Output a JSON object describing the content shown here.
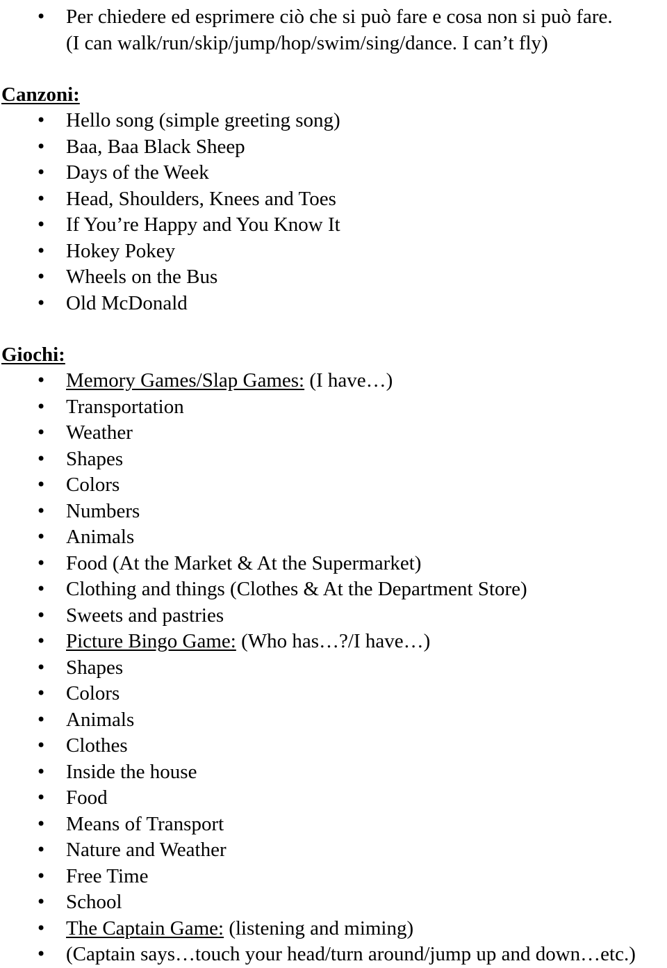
{
  "document": {
    "bullet_glyph": "•",
    "intro": {
      "line1": "Per chiedere ed esprimere ciò che si può fare e cosa non si può fare.",
      "line2": "(I can walk/run/skip/jump/hop/swim/sing/dance. I can’t fly)"
    },
    "sections": [
      {
        "heading": "Canzoni:",
        "items": [
          {
            "text": "Hello song (simple greeting song)",
            "underlined_prefix": ""
          },
          {
            "text": "Baa, Baa Black Sheep",
            "underlined_prefix": ""
          },
          {
            "text": "Days of the Week",
            "underlined_prefix": ""
          },
          {
            "text": "Head, Shoulders, Knees and Toes",
            "underlined_prefix": ""
          },
          {
            "text": "If You’re Happy and You Know It",
            "underlined_prefix": ""
          },
          {
            "text": "Hokey Pokey",
            "underlined_prefix": ""
          },
          {
            "text": "Wheels on the Bus",
            "underlined_prefix": ""
          },
          {
            "text": "Old McDonald",
            "underlined_prefix": ""
          }
        ]
      },
      {
        "heading": "Giochi:",
        "items": [
          {
            "underlined_prefix": "Memory Games/Slap Games:",
            "text": " (I have…)"
          },
          {
            "underlined_prefix": "",
            "text": "Transportation"
          },
          {
            "underlined_prefix": "",
            "text": "Weather"
          },
          {
            "underlined_prefix": "",
            "text": "Shapes"
          },
          {
            "underlined_prefix": "",
            "text": "Colors"
          },
          {
            "underlined_prefix": "",
            "text": "Numbers"
          },
          {
            "underlined_prefix": "",
            "text": "Animals"
          },
          {
            "underlined_prefix": "",
            "text": "Food (At the Market & At the Supermarket)"
          },
          {
            "underlined_prefix": "",
            "text": "Clothing and things (Clothes & At the Department Store)"
          },
          {
            "underlined_prefix": "",
            "text": "Sweets and pastries"
          },
          {
            "underlined_prefix": "Picture Bingo Game:",
            "text": " (Who has…?/I have…)"
          },
          {
            "underlined_prefix": "",
            "text": "Shapes"
          },
          {
            "underlined_prefix": "",
            "text": "Colors"
          },
          {
            "underlined_prefix": "",
            "text": "Animals"
          },
          {
            "underlined_prefix": "",
            "text": "Clothes"
          },
          {
            "underlined_prefix": "",
            "text": "Inside the house"
          },
          {
            "underlined_prefix": "",
            "text": "Food"
          },
          {
            "underlined_prefix": "",
            "text": "Means of Transport"
          },
          {
            "underlined_prefix": "",
            "text": "Nature and Weather"
          },
          {
            "underlined_prefix": "",
            "text": "Free Time"
          },
          {
            "underlined_prefix": "",
            "text": "School"
          },
          {
            "underlined_prefix": "The Captain Game:",
            "text": "  (listening and miming)"
          },
          {
            "underlined_prefix": "",
            "text": "(Captain says…touch your head/turn around/jump up and down…etc.)"
          }
        ]
      }
    ]
  }
}
